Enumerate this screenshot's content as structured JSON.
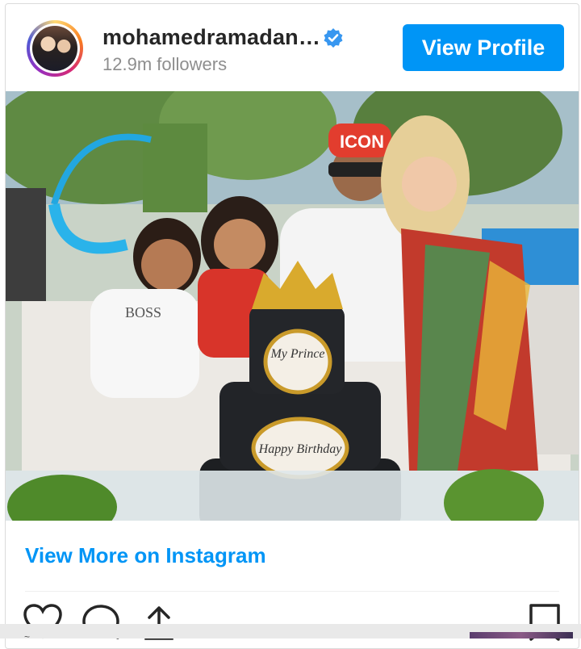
{
  "post": {
    "username": "mohamedramadan…",
    "followers": "12.9m followers",
    "verified": true,
    "view_profile_label": "View Profile",
    "image_alt": "Family birthday photo with cake",
    "cake_top_text": "My Prince",
    "cake_bottom_text": "Happy Birthday",
    "cap_text": "ICON",
    "shirt_text": "BOSS"
  },
  "footer": {
    "view_more_label": "View More on Instagram"
  },
  "actions": [
    "heart-icon",
    "comment-icon",
    "share-icon",
    "bookmark-icon"
  ],
  "colors": {
    "accent": "#0095f6",
    "text": "#262626",
    "muted": "#8e8e8e"
  }
}
